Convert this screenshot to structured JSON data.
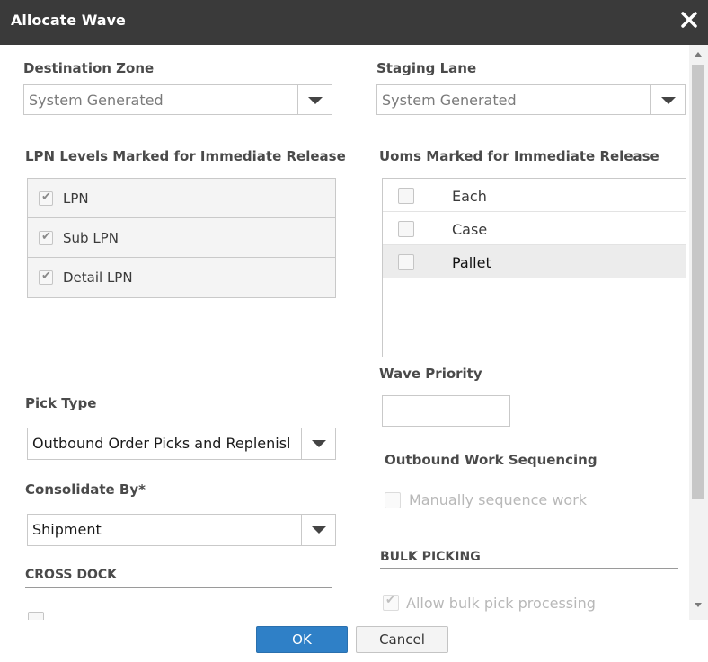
{
  "window": {
    "title": "Allocate Wave"
  },
  "destination_zone": {
    "label": "Destination Zone",
    "value": "System Generated"
  },
  "staging_lane": {
    "label": "Staging Lane",
    "value": "System Generated"
  },
  "lpn_levels": {
    "label": "LPN Levels Marked for Immediate Release",
    "items": [
      {
        "label": "LPN",
        "checked": true
      },
      {
        "label": "Sub LPN",
        "checked": true
      },
      {
        "label": "Detail LPN",
        "checked": true
      }
    ]
  },
  "uoms": {
    "label": "Uoms Marked for Immediate Release",
    "items": [
      {
        "label": "Each",
        "checked": false
      },
      {
        "label": "Case",
        "checked": false
      },
      {
        "label": "Pallet",
        "checked": false
      }
    ]
  },
  "wave_priority": {
    "label": "Wave Priority",
    "value": ""
  },
  "pick_type": {
    "label": "Pick Type",
    "value": "Outbound Order Picks and Replenisl"
  },
  "outbound_work_sequencing": {
    "label": "Outbound Work Sequencing",
    "manual_label": "Manually sequence work"
  },
  "consolidate_by": {
    "label": "Consolidate By*",
    "value": "Shipment"
  },
  "cross_dock": {
    "label": "CROSS DOCK"
  },
  "bulk_picking": {
    "label": "BULK PICKING",
    "allow_label": "Allow bulk pick processing"
  },
  "footer": {
    "ok_label": "OK",
    "cancel_label": "Cancel"
  },
  "icons": {
    "close": "close-icon",
    "dropdown": "chevron-down-icon",
    "check": "check-icon"
  },
  "colors": {
    "titlebar": "#3a3a3a",
    "primary_button": "#2f80c7"
  }
}
